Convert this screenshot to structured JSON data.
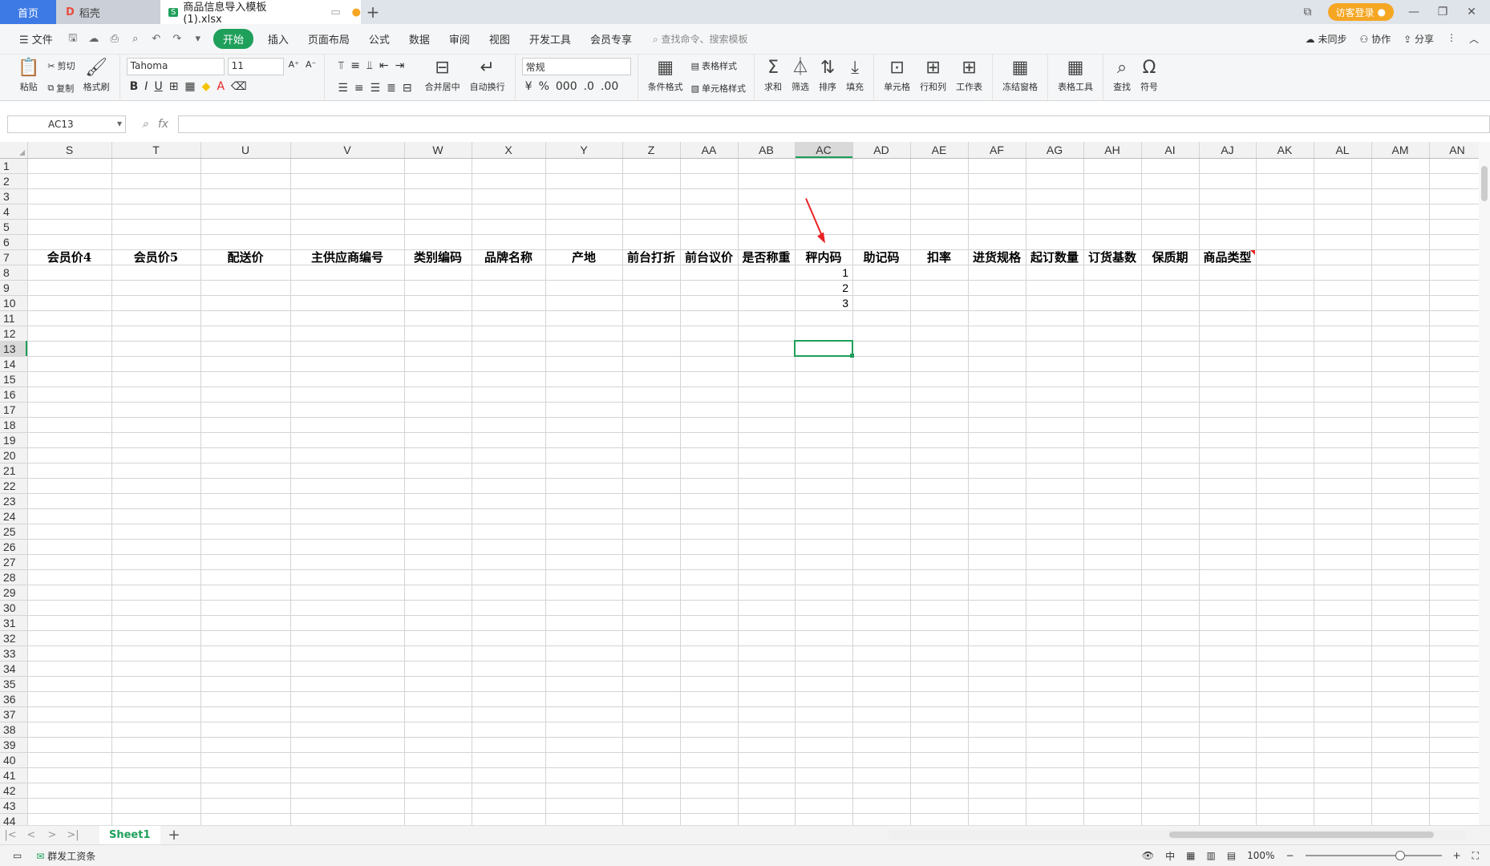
{
  "titlebar": {
    "home_tab": "首页",
    "doc_tab": "稻壳",
    "active_tab": "商品信息导入模板 (1).xlsx",
    "login": "访客登录"
  },
  "menu": {
    "file": "文件",
    "start": "开始",
    "items": [
      "插入",
      "页面布局",
      "公式",
      "数据",
      "审阅",
      "视图",
      "开发工具",
      "会员专享"
    ],
    "search_placeholder": "查找命令、搜索模板",
    "sync": "未同步",
    "collab": "协作",
    "share": "分享"
  },
  "ribbon": {
    "paste": "粘贴",
    "cut": "剪切",
    "copy": "复制",
    "format_painter": "格式刷",
    "font_name": "Tahoma",
    "font_size": "11",
    "merge_center": "合并居中",
    "wrap_text": "自动换行",
    "number_format": "常规",
    "conditional_format": "条件格式",
    "table_style": "表格样式",
    "cell_style": "单元格样式",
    "sum": "求和",
    "filter": "筛选",
    "sort": "排序",
    "fill": "填充",
    "cell": "单元格",
    "row_col": "行和列",
    "worksheet": "工作表",
    "freeze": "冻结窗格",
    "table_tools": "表格工具",
    "find": "查找",
    "symbol": "符号"
  },
  "formula_bar": {
    "name_box": "AC13",
    "fx": "fx",
    "content": ""
  },
  "sheet": {
    "columns": [
      "S",
      "T",
      "U",
      "V",
      "W",
      "X",
      "Y",
      "Z",
      "AA",
      "AB",
      "AC",
      "AD",
      "AE",
      "AF",
      "AG",
      "AH",
      "AI",
      "AJ",
      "AK",
      "AL",
      "AM",
      "AN"
    ],
    "headers_row": 7,
    "headers": [
      "会员价4",
      "会员价5",
      "配送价",
      "主供应商编号",
      "类别编码",
      "品牌名称",
      "产地",
      "前台打折",
      "前台议价",
      "是否称重",
      "秤内码",
      "助记码",
      "扣率",
      "进货规格",
      "起订数量",
      "订货基数",
      "保质期",
      "商品类型"
    ],
    "values_column": "AC",
    "values": [
      {
        "row": 8,
        "value": "1"
      },
      {
        "row": 9,
        "value": "2"
      },
      {
        "row": 10,
        "value": "3"
      }
    ],
    "selected_cell": "AC13",
    "row_count": 44
  },
  "sheet_tabs": {
    "active": "Sheet1"
  },
  "status": {
    "payroll": "群发工资条",
    "zoom": "100%"
  },
  "colors": {
    "accent_green": "#1e9f5a",
    "arrow_red": "#e82323",
    "home_blue": "#3d7ae5"
  }
}
